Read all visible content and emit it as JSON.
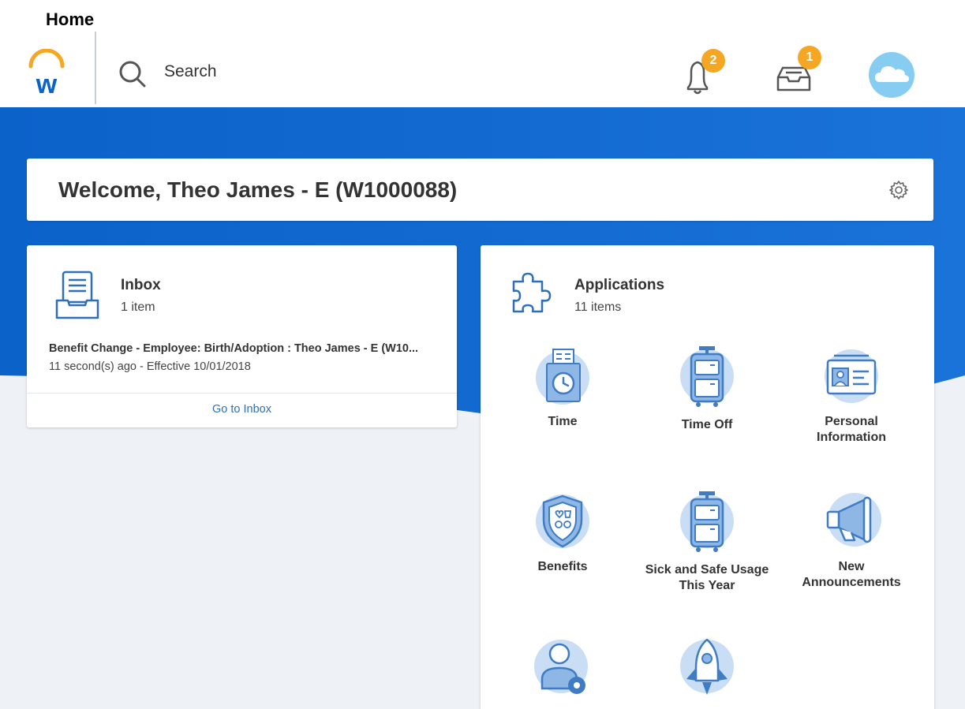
{
  "page": {
    "label": "Home"
  },
  "header": {
    "search_placeholder": "Search",
    "notifications_count": "2",
    "inbox_count": "1"
  },
  "welcome": {
    "text": "Welcome, Theo James - E (W1000088)"
  },
  "inbox_card": {
    "title": "Inbox",
    "count": "1 item",
    "task_title": "Benefit Change - Employee: Birth/Adoption : Theo James - E (W10...",
    "task_meta": "11 second(s) ago - Effective 10/01/2018",
    "link": "Go to Inbox"
  },
  "applications": {
    "title": "Applications",
    "count": "11 items",
    "items": [
      {
        "label": "Time",
        "icon": "time-clock-icon"
      },
      {
        "label": "Time Off",
        "icon": "luggage-icon"
      },
      {
        "label": "Personal Information",
        "icon": "id-card-icon"
      },
      {
        "label": "Benefits",
        "icon": "benefits-shield-icon"
      },
      {
        "label": "Sick and Safe Usage This Year",
        "icon": "luggage-icon"
      },
      {
        "label": "New Announcements",
        "icon": "megaphone-icon"
      },
      {
        "label": "",
        "icon": "person-gear-icon"
      },
      {
        "label": "",
        "icon": "rocket-icon"
      }
    ]
  },
  "colors": {
    "brand_blue": "#0b62c9",
    "brand_orange": "#f5a623",
    "badge_orange": "#f5a623",
    "icon_blue": "#3f7cc4",
    "icon_bg": "#c9def4",
    "link_blue": "#2e6fb7",
    "avatar_bg": "#87cdf2"
  }
}
